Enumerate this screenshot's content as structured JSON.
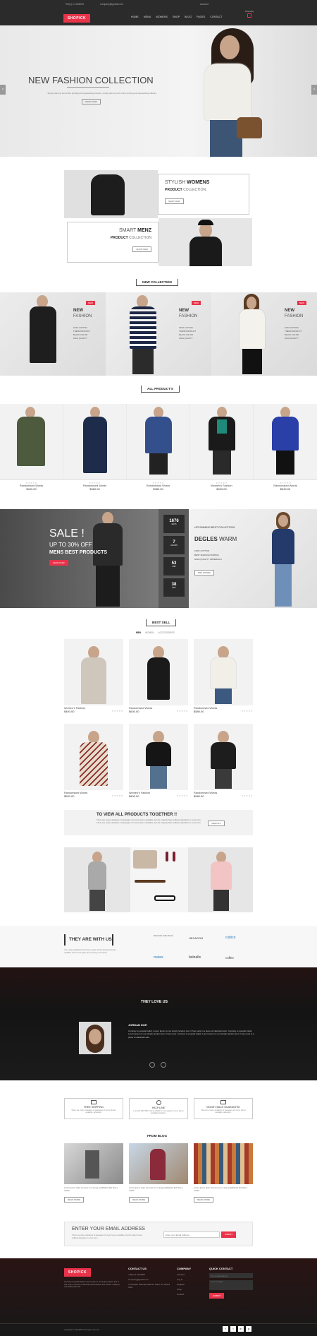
{
  "topbar": {
    "phone": "+00(1) 2-1234000",
    "email": "company@gmail.com",
    "account": "account",
    "logo": "SHOPICK",
    "cart_label": "0 Item(s)"
  },
  "nav": [
    "HOME",
    "MENU",
    "WOMENS",
    "SHOP",
    "BLOG",
    "PAGES",
    "CONTACT"
  ],
  "hero": {
    "title": "NEW FASHION COLLECTION",
    "text": "Simply dummy text of the printing and typesetting industry. simply dummy text of the printing and typesetting industry.",
    "btn": "SHOP NOW"
  },
  "promo": {
    "w_small": "STYLISH",
    "w_big": "WOMENS",
    "w_sub1": "PRODUCT",
    "w_sub2": "COLLECTION",
    "w_btn": "SHOP NOW",
    "m_small": "SMART",
    "m_big": "MENZ",
    "m_sub1": "PRODUCT",
    "m_sub2": "COLLECTION",
    "m_btn": "SHOP NOW"
  },
  "new_collection": {
    "title": "NEW COLLECTION",
    "badge": "NEW",
    "line1": "NEW",
    "line2": "FASHION",
    "bullets": [
      "100% COTTON",
      "TREND PRODUCT",
      "BLACK COLOR",
      "HIGH QUALITY"
    ]
  },
  "all_products": {
    "title": "ALL PRODUCT'S",
    "items": [
      {
        "name": "Randomised Words",
        "price": "$400.00"
      },
      {
        "name": "Randomised Words",
        "price": "$360.00"
      },
      {
        "name": "Randomised Words",
        "price": "$380.00"
      },
      {
        "name": "Women's Fashion",
        "price": "$400.00"
      },
      {
        "name": "Randomised Words",
        "price": "$630.00"
      }
    ]
  },
  "sale": {
    "title": "SALE !",
    "up_to": "UP TO",
    "pct": "30%",
    "off": "OFF",
    "sub": "MENS BEST PRODUCTS",
    "btn": "SHOP NOW",
    "counters": [
      {
        "n": "1676",
        "l": "DAYS"
      },
      {
        "n": "7",
        "l": "HOURS"
      },
      {
        "n": "53",
        "l": "MIN"
      },
      {
        "n": "38",
        "l": "SEC"
      }
    ],
    "up_label": "UPCOMMING BEST COLLECTION",
    "up_t1": "DEGLES",
    "up_t2": "WARM",
    "up_bullets": [
      "100% COTTON",
      "BEST MANUFACTURING",
      "HIGH QUALITY MATERIALS"
    ],
    "up_btn": "PRE ORDER"
  },
  "best_sell": {
    "title": "BEST SELL",
    "tabs": [
      "MEN",
      "WOMEN",
      "ACCESSORIES"
    ],
    "items": [
      {
        "name": "Women's Fashion",
        "price": "$400.00"
      },
      {
        "name": "Randomised Words",
        "price": "$600.00"
      },
      {
        "name": "Randomised Words",
        "price": "$580.00"
      },
      {
        "name": "Randomised Words",
        "price": "$500.00"
      },
      {
        "name": "Women's Fashion",
        "price": "$800.00"
      },
      {
        "name": "Randomised Words",
        "price": "$580.00"
      }
    ]
  },
  "view_all": {
    "title": "TO VIEW ALL PRODUCTS TOGETHER !!",
    "text": "There are many variations of passages of Lorem Ipsum available, but the majority have suffered alteration in some form. There are many variations of passages of Lorem Ipsum available, but the majority have suffered alteration in some form.",
    "btn": "VIEW ALL"
  },
  "partners": {
    "title": "THEY ARE WITH US",
    "text": "It is a long established fact that a reader will be distracted by the readable content of a page when looking at its layout.",
    "logos": [
      "Mountain Adventures",
      "HEXAGON",
      "cubico",
      "mates",
      "bolnells",
      "coffee"
    ]
  },
  "testimonial": {
    "title": "THEY LOVE US",
    "name": "JORDAN DOE",
    "quote": "Contrary to popular belief, Lorem Ipsum is not simply random text. It has roots in a piece of classical Latin. Contrary to popular belief, Lorem Ipsum is not simply random text. It has roots. Contrary to popular belief, Lorem Ipsum is not simply random text. It has roots in a piece of classical Latin."
  },
  "services": [
    {
      "title": "FREE SHIPPING",
      "text": "There are many variations of passages of Lorem Ipsum available. alteration."
    },
    {
      "title": "HELP LINE",
      "text": "(+1) 123 456 7890, Call and Mail for any support Lorem Ipsum available alteration."
    },
    {
      "title": "MONEY BACK GUARANTEE",
      "text": "There are many variations of passages of Lorem Ipsum available. alteration."
    }
  ],
  "blog": {
    "title": "FROM BLOG",
    "posts": [
      {
        "text": "Lorem ipsum dolor sit amet, It is a long established fact that a reader",
        "btn": "READ MORE"
      },
      {
        "text": "Lorem ipsum dolor sit amet, It is a long established fact that a reader",
        "btn": "READ MORE"
      },
      {
        "text": "Lorem ipsum dolor sit amet, It is a long established fact that a reader",
        "btn": "READ MORE"
      }
    ]
  },
  "newsletter": {
    "title": "ENTER YOUR EMAIL ADDRESS",
    "text": "There are many variations of passages of Lorem Ipsum available, but the majority have suffered alteration in some form.",
    "placeholder": "Enter your Email Address",
    "btn": "SUBMIT"
  },
  "footer": {
    "logo": "SHOPICK",
    "about": "Contrary to popular belief, Lorem Ipsum is not simply random text. It has roots in a piece of classical Latin literature from 45 BC, making it over 2000 years old.",
    "contact_title": "CONTACT US",
    "phone": "+00(1) 2-1234000",
    "email": "company@gmail.com",
    "address": "7710 Main Ranches Ranchi North NY 10021 USA",
    "company_title": "COMPANY",
    "company_links": [
      "Account",
      "Log In",
      "Register",
      "Shop",
      "Contact"
    ],
    "quick_title": "QUICK CONTACT",
    "q_email": "Your email address",
    "q_msg": "Your message",
    "q_btn": "SUBMIT",
    "copyright": "Copyright © SHOPICK All right reserved"
  }
}
